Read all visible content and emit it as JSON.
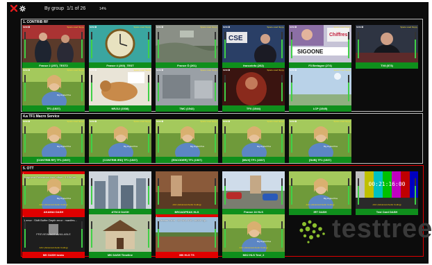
{
  "toolbar": {
    "grouping_label": "By group",
    "page_indicator": "1/1 of 26",
    "stat": "14%"
  },
  "icons": {
    "close": "close-icon",
    "settings": "gear-icon"
  },
  "colors": {
    "ok": "#0f8f1c",
    "alarm": "#e00000",
    "meter": "#3fd046",
    "audio_label": "#ffd400"
  },
  "groups": [
    {
      "title": "1. CONTRIB RF",
      "tiles": [
        {
          "caption": "France 2 (257)_TEST2",
          "status": "ok",
          "scene": "studio",
          "badge": "SCM ❂",
          "flag": "Space used floppy"
        },
        {
          "caption": "France 4 (260)_TEST",
          "status": "ok",
          "scene": "clock",
          "badge": "SCM ❂",
          "flag": "Space used floppy"
        },
        {
          "caption": "France Ô (261)",
          "status": "ok",
          "scene": "aerial",
          "badge": "SCM ❂",
          "flag": "Space used floppy"
        },
        {
          "caption": "franceinfo (262)",
          "status": "ok",
          "scene": "news",
          "badge": "SCM ❂",
          "flag": "Space used floppy"
        },
        {
          "caption": "F3 Bretagne (274)",
          "status": "ok",
          "scene": "game",
          "badge": "SCM ❂",
          "flag": "Space used floppy"
        },
        {
          "caption": "TV8 (573)",
          "status": "ok",
          "scene": "speaker",
          "badge": "SCM ❂",
          "flag": "Space used floppy"
        },
        {
          "caption": "TF1 (1537)",
          "status": "ok",
          "scene": "woman",
          "badge": "SCM ❂",
          "flag": "Space used floppy"
        },
        {
          "caption": "NRJ12 (1538)",
          "status": "ok",
          "scene": "dog",
          "badge": "SCM ❂",
          "flag": "Space used floppy"
        },
        {
          "caption": "TMC (1542)",
          "status": "ok",
          "scene": "grey",
          "badge": "SCM ❂",
          "flag": "Space used floppy"
        },
        {
          "caption": "TFX (1544)",
          "status": "ok",
          "scene": "red",
          "badge": "SCM ❂",
          "flag": "Space used floppy"
        },
        {
          "caption": "LCP (1545)",
          "status": "ok",
          "scene": "sky",
          "badge": "SCM ❂",
          "flag": "Space used floppy"
        }
      ]
    },
    {
      "title": "4.a TF1 Macro Service",
      "tiles": [
        {
          "caption": "[CONTRIB RF] TF1 (1537)",
          "status": "ok",
          "scene": "woman",
          "badge": "SCM ❂",
          "flag": "Space used floppy"
        },
        {
          "caption": "[CONTRIB IRD] TF1 (1537)",
          "status": "ok",
          "scene": "woman",
          "badge": "SCM ❂",
          "flag": "Space used floppy"
        },
        {
          "caption": "[ENCODER] TF1 (1537)",
          "status": "ok",
          "scene": "woman",
          "badge": "SCM ❂",
          "flag": "Space used floppy"
        },
        {
          "caption": "[MUX] TF1 (1537)",
          "status": "ok",
          "scene": "woman",
          "badge": "SCM ❂",
          "flag": "Space used floppy"
        },
        {
          "caption": "[SUB] TF1 (1537)",
          "status": "ok",
          "scene": "woman",
          "badge": "SCM ❂",
          "flag": "Space used floppy"
        }
      ]
    },
    {
      "title": "5. OTT",
      "tiles": [
        {
          "caption": "AKAMAI DASH",
          "status": "alarm",
          "scene": "woman",
          "badge": "!",
          "error": "Fragment Reference time offset : 13.96 se..",
          "audio": "AAC (Advanced Audio Coding)"
        },
        {
          "caption": "ATSC3 DASH",
          "status": "ok",
          "scene": "city",
          "badge": "",
          "audio": ""
        },
        {
          "caption": "BROADPEAK HLS",
          "status": "ok",
          "scene": "brown",
          "badge": "",
          "audio": "AAC (Advanced Audio Coding)"
        },
        {
          "caption": "France 24 HLS",
          "status": "ok",
          "scene": "cars",
          "badge": "",
          "audio": ""
        },
        {
          "caption": "IRT DASH",
          "status": "ok",
          "scene": "woman",
          "badge": "",
          "audio": "AAC (Advanced Audio Coding)"
        },
        {
          "caption": "Test Card DASH",
          "status": "ok",
          "scene": "bars",
          "badge": "",
          "timecode": "00:21:16:00",
          "audio": "AAC (Advanced Audio Coding)"
        },
        {
          "caption": "MK DASH tosbs",
          "status": "alarm",
          "scene": "preview",
          "badge": "!",
          "error": "1 error : Shift Buffer Depth error : manifes...",
          "preview": "PREVIEW NOT AVAILABLE",
          "audio": "AAC (Advanced Audio Coding)"
        },
        {
          "caption": "MK DASH Timeline",
          "status": "ok",
          "scene": "house",
          "badge": "",
          "audio": ""
        },
        {
          "caption": "MK HLS TS",
          "status": "alarm",
          "scene": "field",
          "badge": "!",
          "error": "1 Stream Error : 60 NAL AAC 16000 Sp..",
          "audio": ""
        },
        {
          "caption": "MX2 HLS Test_2",
          "status": "ok",
          "scene": "woman",
          "badge": "",
          "audio": "AAC (Advanced Audio Coding)"
        }
      ]
    }
  ],
  "logo": {
    "text": "testtree"
  }
}
